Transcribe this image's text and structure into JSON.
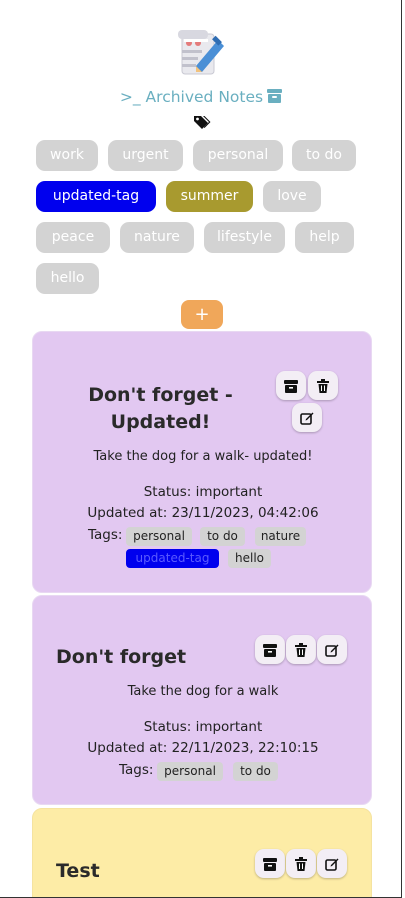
{
  "header": {
    "title": ">_ Archived Notes",
    "logo_icon": "notepad-pencil-icon",
    "archive_icon": "archive-box-icon",
    "tags_icon": "tags-icon"
  },
  "tag_filters": [
    {
      "label": "work",
      "style": "default"
    },
    {
      "label": "urgent",
      "style": "default"
    },
    {
      "label": "personal",
      "style": "default"
    },
    {
      "label": "to do",
      "style": "default"
    },
    {
      "label": "updated-tag",
      "style": "blue"
    },
    {
      "label": "summer",
      "style": "olive"
    },
    {
      "label": "love",
      "style": "default"
    },
    {
      "label": "peace",
      "style": "default"
    },
    {
      "label": "nature",
      "style": "default"
    },
    {
      "label": "lifestyle",
      "style": "default"
    },
    {
      "label": "help",
      "style": "default"
    },
    {
      "label": "hello",
      "style": "default"
    }
  ],
  "add_button": "+",
  "notes": [
    {
      "title_line1": "Don't forget -",
      "title_line2": "Updated!",
      "description": "Take the dog for a walk- updated!",
      "status": "Status: important",
      "updated": "Updated at: 23/11/2023, 04:42:06",
      "tags_label": "Tags:",
      "tags": [
        "personal",
        "to do",
        "nature",
        "updated-tag",
        "hello"
      ],
      "color": "#e2c8f1"
    },
    {
      "title_line1": "Don't forget",
      "description": "Take the dog for a walk",
      "status": "Status: important",
      "updated": "Updated at: 22/11/2023, 22:10:15",
      "tags_label": "Tags:",
      "tags": [
        "personal",
        "to do"
      ],
      "color": "#e2c8f1"
    },
    {
      "title_line1": "Test",
      "color": "#fdeca6"
    }
  ],
  "note_actions": {
    "archive_icon": "archive-box-icon",
    "delete_icon": "trash-icon",
    "edit_icon": "edit-icon"
  },
  "colors": {
    "title_accent": "#6aafc0",
    "tag_default": "#d3d3d3",
    "tag_blue": "#0000ee",
    "tag_olive": "#a89a2f",
    "add_button": "#f0a75a",
    "note_purple": "#e2c8f1",
    "note_yellow": "#fdeca6"
  }
}
